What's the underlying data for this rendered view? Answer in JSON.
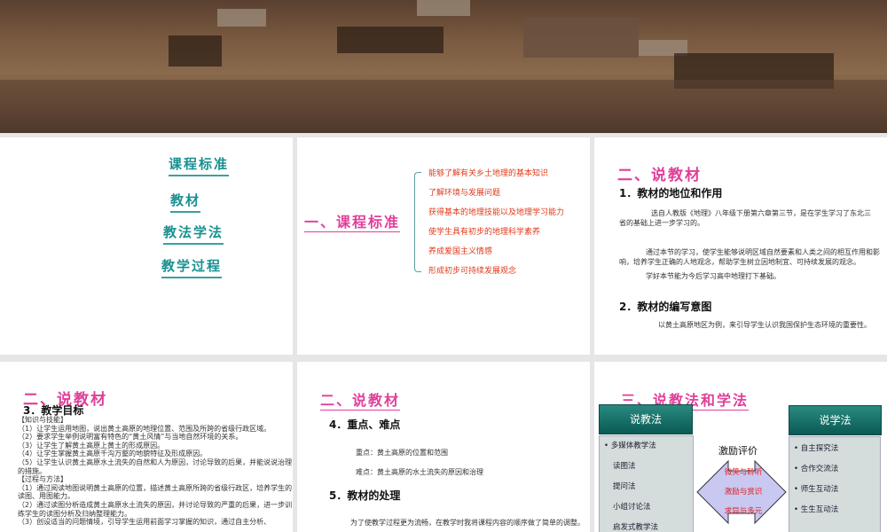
{
  "toc": [
    "课程标准",
    "教材",
    "教法学法",
    "教学过程"
  ],
  "slide2": {
    "title": "一、课程标准",
    "items": [
      "能够了解有关乡土地理的基本知识",
      "了解环境与发展问题",
      "获得基本的地理技能以及地理学习能力",
      "使学生具有初步的地理科学素养",
      "养成爱国主义情感",
      "形成初步可持续发展观念"
    ]
  },
  "slide3": {
    "title": "二、说教材",
    "s1": "1．教材的地位和作用",
    "p1": "选自人教版《地理》八年级下册第六章第三节，是在学生学习了东北三省的基础上进一步学习的。",
    "p2": "通过本节的学习，使学生能够说明区域自然要素和人类之间的相互作用和影响，培养学生正确的人地观念，帮助学生树立因地制宜、可持续发展的观念。",
    "p3": "学好本节能为今后学习高中地理打下基础。",
    "s2": "2．教材的编写意图",
    "p4": "以黄土高原地区为例，来引导学生认识我国保护生态环境的重要性。"
  },
  "slide4": {
    "title": "二、说教材",
    "s": "3．教学目标",
    "lines": [
      "【知识与技能】",
      "（1）让学生运用地图，说出黄土高原的地理位置、范围及所跨的省级行政区域。",
      "（2）要求学生举例说明富有特色的“黄土风情”与当地自然环境的关系。",
      "（3）让学生了解黄土高原上黄土的形成原因。",
      "（4）让学生掌握黄土高原千沟万壑的地貌特征及形成原因。",
      "（5）让学生认识黄土高原水土流失的自然和人为原因，讨论导致的后果，并能说说治理的措施。",
      "【过程与方法】",
      "（1）通过阅读地图说明黄土高原的位置，描述黄土高原所跨的省级行政区，培养学生的读图、用图能力。",
      "（2）通过读图分析造成黄土高原水土流失的原因，并讨论导致的严重的后果，进一步训练学生的读图分析及归纳整理能力。",
      "（3）创设适当的问题情境，引导学生运用前面学习掌握的知识，通过自主分析、"
    ]
  },
  "slide5": {
    "title": "二、说教材",
    "s1": "4．重点、难点",
    "p1": "重点：黄土高原的位置和范围",
    "p2": "难点：黄土高原的水土流失的原因和治理",
    "s2": "5．教材的处理",
    "p3": "为了使教学过程更为流畅，在教学时我将课程内容的顺序做了简单的调整。"
  },
  "slide6": {
    "title": "三、说教法和学法",
    "teach": "说教法",
    "teach_items": [
      "• 多媒体教学法",
      "读图法",
      "提问法",
      "小组讨论法",
      "启发式教学法"
    ],
    "learn": "说学法",
    "learn_items": [
      "• 自主探究法",
      "• 合作交流法",
      "• 师生互动法",
      "• 生生互动法"
    ],
    "center": "激励评价",
    "arrow": [
      "微笑与聆听",
      "激励与赏识",
      "求异与多元"
    ]
  }
}
